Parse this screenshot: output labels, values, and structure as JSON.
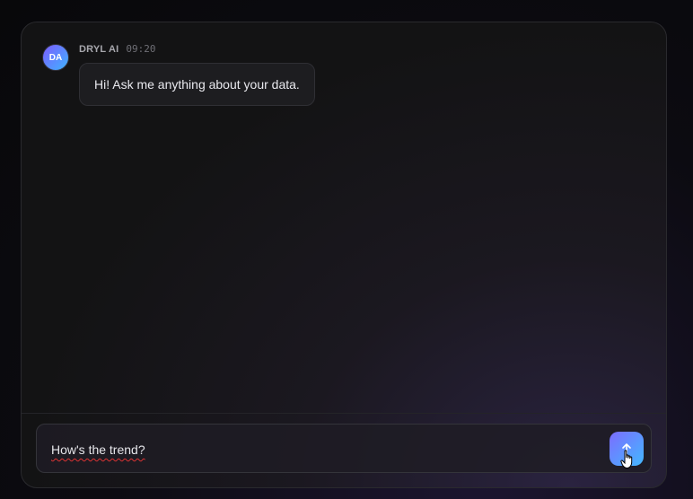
{
  "message": {
    "avatar_initials": "DA",
    "sender": "DRYL AI",
    "time": "09:20",
    "text": "Hi! Ask me anything about your data."
  },
  "composer": {
    "value": "How's the trend?",
    "send_icon": "arrow-up-icon"
  },
  "colors": {
    "accent_start": "#7c6cff",
    "accent_end": "#43b8ff"
  }
}
